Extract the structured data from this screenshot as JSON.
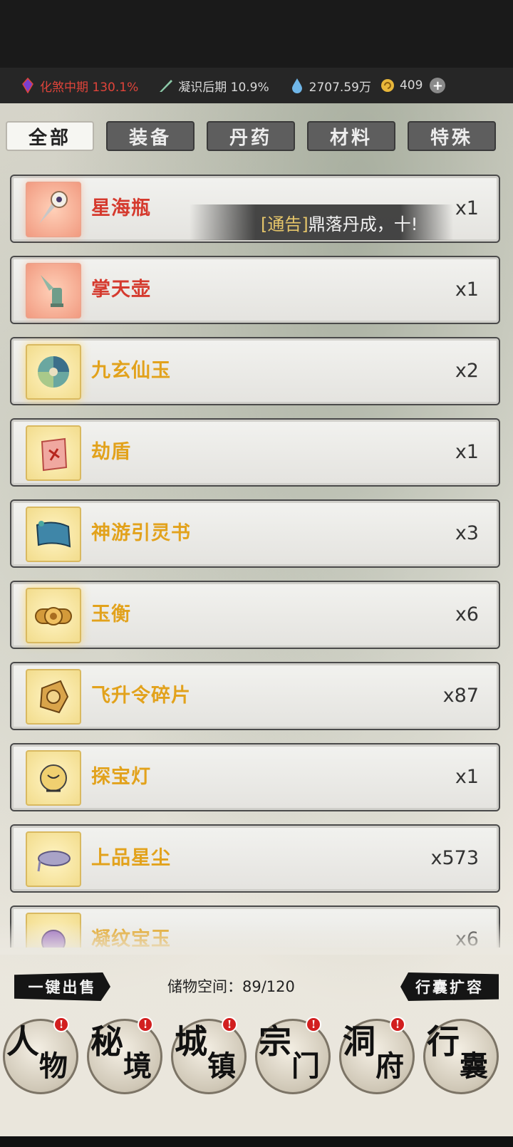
{
  "status": {
    "realm1": "化煞中期 130.1%",
    "realm2": "凝识后期 10.9%",
    "spirit_stones": "2707.59万",
    "jade": "409",
    "plus_symbol": "+"
  },
  "tabs": [
    {
      "label": "全部",
      "active": true
    },
    {
      "label": "装备",
      "active": false
    },
    {
      "label": "丹药",
      "active": false
    },
    {
      "label": "材料",
      "active": false
    },
    {
      "label": "特殊",
      "active": false
    }
  ],
  "notice": {
    "tag": "[通告]",
    "text": "鼎落丹成，十!"
  },
  "items": [
    {
      "name": "星海瓶",
      "count": "x1",
      "rarity": "red",
      "icon": "star-sea-bottle-icon"
    },
    {
      "name": "掌天壶",
      "count": "x1",
      "rarity": "red",
      "icon": "palm-heaven-pot-icon"
    },
    {
      "name": "九玄仙玉",
      "count": "x2",
      "rarity": "gold",
      "icon": "jade-swirl-icon"
    },
    {
      "name": "劫盾",
      "count": "x1",
      "rarity": "gold",
      "icon": "talisman-shield-icon"
    },
    {
      "name": "神游引灵书",
      "count": "x3",
      "rarity": "gold",
      "icon": "scroll-book-icon"
    },
    {
      "name": "玉衡",
      "count": "x6",
      "rarity": "gold",
      "icon": "jade-balance-icon"
    },
    {
      "name": "飞升令碎片",
      "count": "x87",
      "rarity": "gold",
      "icon": "ascension-token-shard-icon"
    },
    {
      "name": "探宝灯",
      "count": "x1",
      "rarity": "gold",
      "icon": "treasure-lamp-icon"
    },
    {
      "name": "上品星尘",
      "count": "x573",
      "rarity": "gold",
      "icon": "stardust-icon"
    },
    {
      "name": "凝纹宝玉",
      "count": "x6",
      "rarity": "gold",
      "icon": "purple-jade-icon"
    }
  ],
  "bottom": {
    "sell_all": "一键出售",
    "storage": "储物空间：89/120",
    "expand": "行囊扩容"
  },
  "nav": [
    {
      "c1": "人",
      "c2": "物",
      "badge": "!"
    },
    {
      "c1": "秘",
      "c2": "境",
      "badge": "!"
    },
    {
      "c1": "城",
      "c2": "镇",
      "badge": "!"
    },
    {
      "c1": "宗",
      "c2": "门",
      "badge": "!"
    },
    {
      "c1": "洞",
      "c2": "府",
      "badge": "!"
    },
    {
      "c1": "行",
      "c2": "囊",
      "badge": ""
    }
  ],
  "colors": {
    "red_name": "#d53a2e",
    "gold_name": "#e2a21c",
    "badge": "#d21f1f"
  }
}
